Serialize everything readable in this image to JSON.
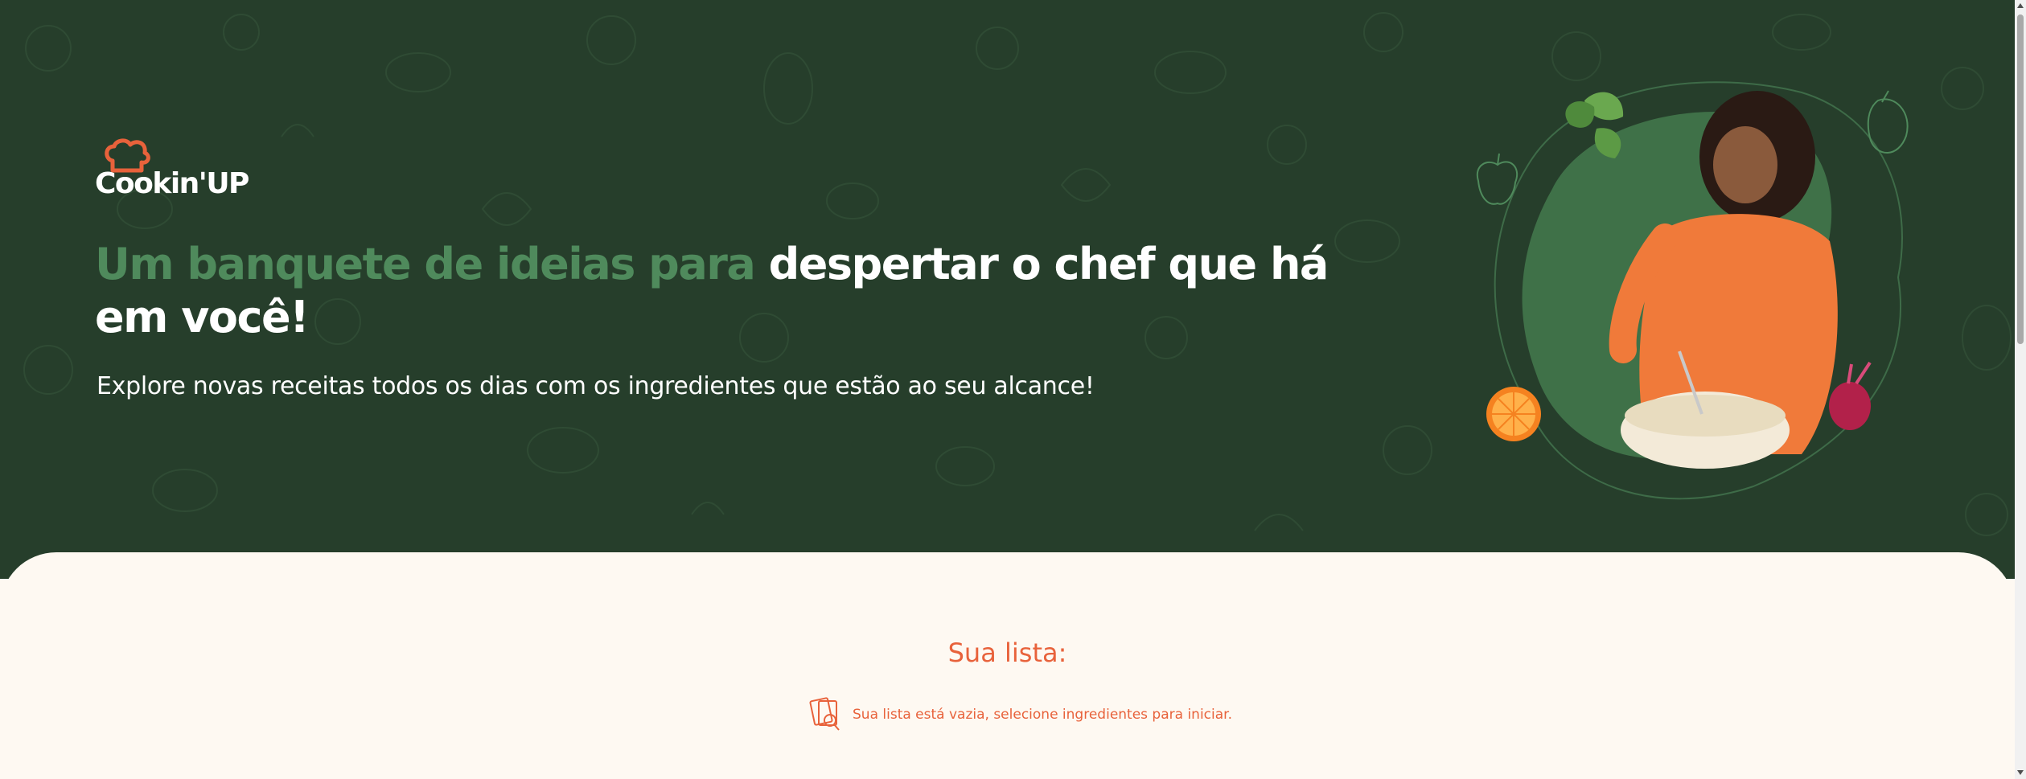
{
  "brand": {
    "name": "Cookin'UP"
  },
  "hero": {
    "headline_accent": "Um banquete de ideias para ",
    "headline_main": "despertar o chef que há em você!",
    "subtitle": "Explore novas receitas todos os dias com os ingredientes que estão ao seu alcance!"
  },
  "list": {
    "title": "Sua lista:",
    "empty_message": "Sua lista está vazia, selecione ingredientes para iniciar."
  },
  "colors": {
    "hero_bg": "#263e2b",
    "accent_green": "#4f8a5c",
    "accent_orange": "#e8623b",
    "content_bg": "#fef9f2"
  },
  "icons": [
    "chef-hat-icon",
    "empty-list-icon",
    "basil-leaf-icon",
    "bell-pepper-icon",
    "eggplant-icon",
    "orange-slice-icon",
    "beet-icon"
  ]
}
